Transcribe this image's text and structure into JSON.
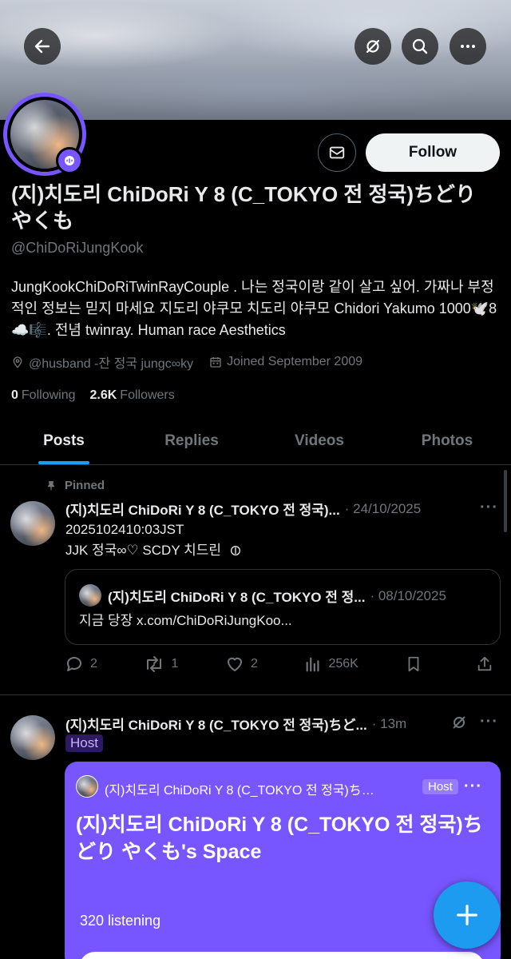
{
  "profile": {
    "display_name": "(지)치도리 ChiDoRi Y 8 (C_TOKYO 전 정국)ちどり やくも",
    "handle": "@ChiDoRiJungKook",
    "bio": "JungKookChiDoRiTwinRayCouple . 나는 정국이랑 같이 살고 싶어. 가짜나 부정적인 정보는 믿지 마세요 지도리 야쿠모 치도리 야쿠모 Chidori Yakumo 1000🕊️8☁️🎼. 전념 twinray. Human race Aesthetics",
    "location": "@husband -잔 정국 jungc∞ky",
    "joined": "Joined September 2009",
    "following_count": "0",
    "following_label": "Following",
    "followers_count": "2.6K",
    "followers_label": "Followers",
    "follow_label": "Follow",
    "host_badge_icon": "spaces-host-icon"
  },
  "tabs": [
    {
      "label": "Posts",
      "active": true
    },
    {
      "label": "Replies",
      "active": false
    },
    {
      "label": "Videos",
      "active": false
    },
    {
      "label": "Photos",
      "active": false
    }
  ],
  "pinned_post": {
    "pinned_label": "Pinned",
    "name": "(지)치도리 ChiDoRi Y 8 (C_TOKYO 전 정국)...",
    "date": "· 24/10/2025",
    "line1": "2025102410:03JST",
    "line2": "JJK 정국∞♡ SCDY 치드린",
    "quote": {
      "name": "(지)치도리 ChiDoRi Y 8 (C_TOKYO 전 정...",
      "date": "· 08/10/2025",
      "text": "지금 당장 x.com/ChiDoRiJungKoo..."
    },
    "replies": "2",
    "reposts": "1",
    "likes": "2",
    "views": "256K"
  },
  "space_post": {
    "name": "(지)치도리 ChiDoRi Y 8 (C_TOKYO 전 정국)ちど...",
    "time": "· 13m",
    "host_label": "Host",
    "card": {
      "host_name": "(지)치도리 ChiDoRi Y 8 (C_TOKYO 전 정국)ち…",
      "host_tag": "Host",
      "title": "(지)치도리 ChiDoRi Y 8 (C_TOKYO 전 정국)ちどり やくも's Space",
      "listening": "320 listening"
    }
  },
  "colors": {
    "accent": "#1d9bf0",
    "spaces_purple": "#7856ff",
    "text_primary": "#e7e9ea",
    "text_secondary": "#71767b"
  }
}
